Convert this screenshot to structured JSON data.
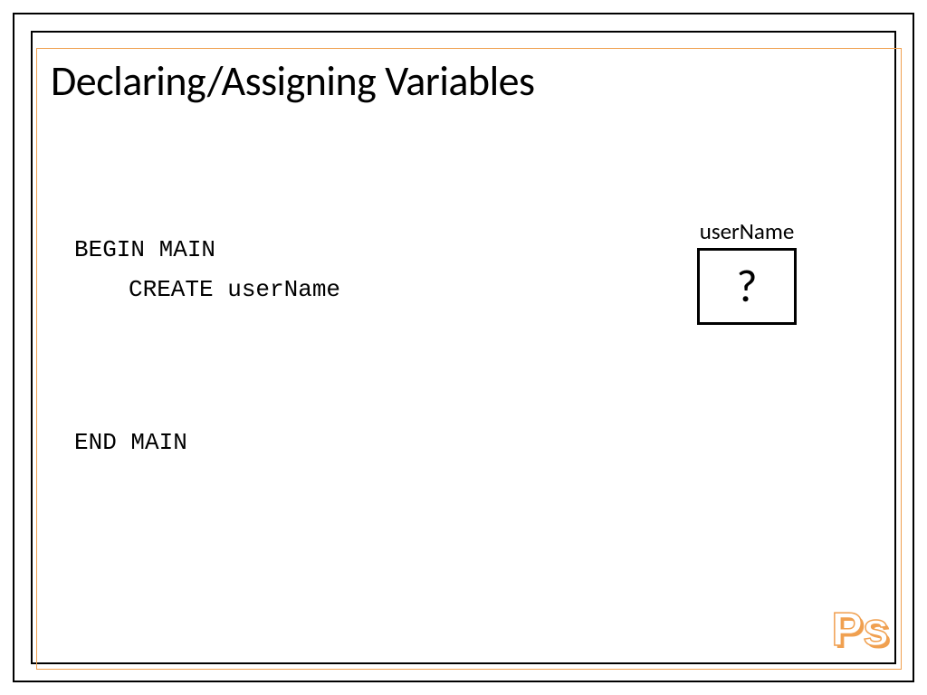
{
  "slide": {
    "title": "Declaring/Assigning Variables",
    "code": {
      "line1": "BEGIN MAIN",
      "line2": "CREATE userName",
      "line3": "END MAIN"
    },
    "variable_box": {
      "label": "userName",
      "value": "?"
    },
    "logo": "Ps"
  }
}
